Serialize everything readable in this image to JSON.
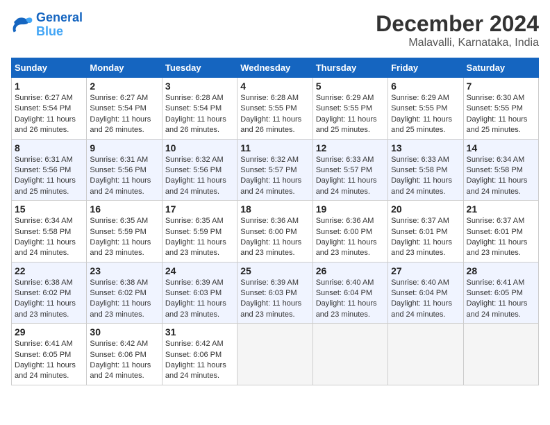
{
  "logo": {
    "line1": "General",
    "line2": "Blue"
  },
  "title": "December 2024",
  "location": "Malavalli, Karnataka, India",
  "days_of_week": [
    "Sunday",
    "Monday",
    "Tuesday",
    "Wednesday",
    "Thursday",
    "Friday",
    "Saturday"
  ],
  "weeks": [
    [
      {
        "day": 1,
        "sunrise": "6:27 AM",
        "sunset": "5:54 PM",
        "daylight": "11 hours and 26 minutes."
      },
      {
        "day": 2,
        "sunrise": "6:27 AM",
        "sunset": "5:54 PM",
        "daylight": "11 hours and 26 minutes."
      },
      {
        "day": 3,
        "sunrise": "6:28 AM",
        "sunset": "5:54 PM",
        "daylight": "11 hours and 26 minutes."
      },
      {
        "day": 4,
        "sunrise": "6:28 AM",
        "sunset": "5:55 PM",
        "daylight": "11 hours and 26 minutes."
      },
      {
        "day": 5,
        "sunrise": "6:29 AM",
        "sunset": "5:55 PM",
        "daylight": "11 hours and 25 minutes."
      },
      {
        "day": 6,
        "sunrise": "6:29 AM",
        "sunset": "5:55 PM",
        "daylight": "11 hours and 25 minutes."
      },
      {
        "day": 7,
        "sunrise": "6:30 AM",
        "sunset": "5:55 PM",
        "daylight": "11 hours and 25 minutes."
      }
    ],
    [
      {
        "day": 8,
        "sunrise": "6:31 AM",
        "sunset": "5:56 PM",
        "daylight": "11 hours and 25 minutes."
      },
      {
        "day": 9,
        "sunrise": "6:31 AM",
        "sunset": "5:56 PM",
        "daylight": "11 hours and 24 minutes."
      },
      {
        "day": 10,
        "sunrise": "6:32 AM",
        "sunset": "5:56 PM",
        "daylight": "11 hours and 24 minutes."
      },
      {
        "day": 11,
        "sunrise": "6:32 AM",
        "sunset": "5:57 PM",
        "daylight": "11 hours and 24 minutes."
      },
      {
        "day": 12,
        "sunrise": "6:33 AM",
        "sunset": "5:57 PM",
        "daylight": "11 hours and 24 minutes."
      },
      {
        "day": 13,
        "sunrise": "6:33 AM",
        "sunset": "5:58 PM",
        "daylight": "11 hours and 24 minutes."
      },
      {
        "day": 14,
        "sunrise": "6:34 AM",
        "sunset": "5:58 PM",
        "daylight": "11 hours and 24 minutes."
      }
    ],
    [
      {
        "day": 15,
        "sunrise": "6:34 AM",
        "sunset": "5:58 PM",
        "daylight": "11 hours and 24 minutes."
      },
      {
        "day": 16,
        "sunrise": "6:35 AM",
        "sunset": "5:59 PM",
        "daylight": "11 hours and 23 minutes."
      },
      {
        "day": 17,
        "sunrise": "6:35 AM",
        "sunset": "5:59 PM",
        "daylight": "11 hours and 23 minutes."
      },
      {
        "day": 18,
        "sunrise": "6:36 AM",
        "sunset": "6:00 PM",
        "daylight": "11 hours and 23 minutes."
      },
      {
        "day": 19,
        "sunrise": "6:36 AM",
        "sunset": "6:00 PM",
        "daylight": "11 hours and 23 minutes."
      },
      {
        "day": 20,
        "sunrise": "6:37 AM",
        "sunset": "6:01 PM",
        "daylight": "11 hours and 23 minutes."
      },
      {
        "day": 21,
        "sunrise": "6:37 AM",
        "sunset": "6:01 PM",
        "daylight": "11 hours and 23 minutes."
      }
    ],
    [
      {
        "day": 22,
        "sunrise": "6:38 AM",
        "sunset": "6:02 PM",
        "daylight": "11 hours and 23 minutes."
      },
      {
        "day": 23,
        "sunrise": "6:38 AM",
        "sunset": "6:02 PM",
        "daylight": "11 hours and 23 minutes."
      },
      {
        "day": 24,
        "sunrise": "6:39 AM",
        "sunset": "6:03 PM",
        "daylight": "11 hours and 23 minutes."
      },
      {
        "day": 25,
        "sunrise": "6:39 AM",
        "sunset": "6:03 PM",
        "daylight": "11 hours and 23 minutes."
      },
      {
        "day": 26,
        "sunrise": "6:40 AM",
        "sunset": "6:04 PM",
        "daylight": "11 hours and 23 minutes."
      },
      {
        "day": 27,
        "sunrise": "6:40 AM",
        "sunset": "6:04 PM",
        "daylight": "11 hours and 24 minutes."
      },
      {
        "day": 28,
        "sunrise": "6:41 AM",
        "sunset": "6:05 PM",
        "daylight": "11 hours and 24 minutes."
      }
    ],
    [
      {
        "day": 29,
        "sunrise": "6:41 AM",
        "sunset": "6:05 PM",
        "daylight": "11 hours and 24 minutes."
      },
      {
        "day": 30,
        "sunrise": "6:42 AM",
        "sunset": "6:06 PM",
        "daylight": "11 hours and 24 minutes."
      },
      {
        "day": 31,
        "sunrise": "6:42 AM",
        "sunset": "6:06 PM",
        "daylight": "11 hours and 24 minutes."
      },
      null,
      null,
      null,
      null
    ]
  ]
}
